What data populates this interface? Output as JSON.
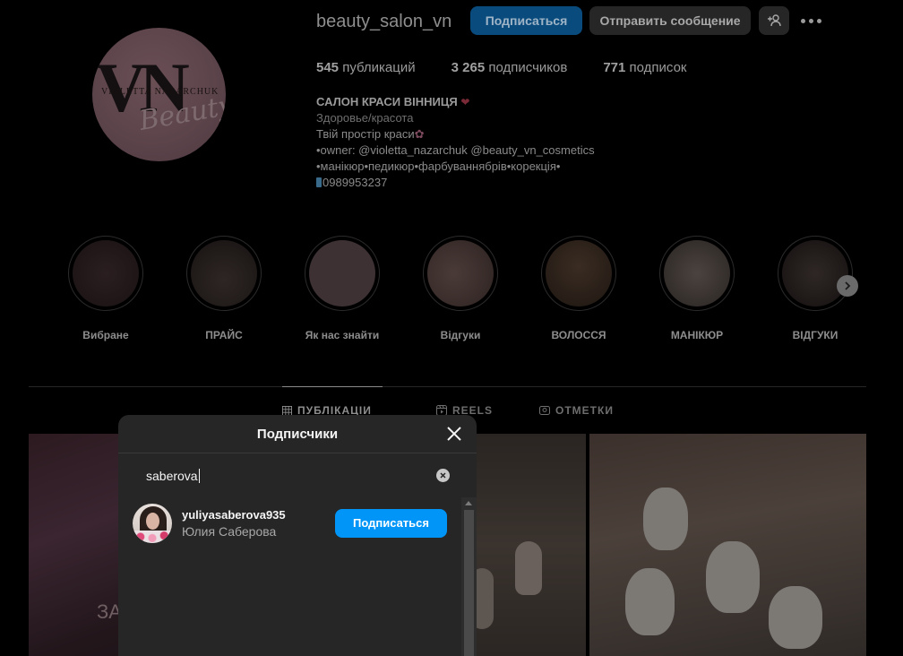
{
  "profile": {
    "username": "beauty_salon_vn",
    "follow_label": "Подписаться",
    "message_label": "Отправить сообщение",
    "avatar": {
      "logo_vn": "VN",
      "logo_name": "VIOLETTA NAZARCHUK",
      "logo_beauty": "Beauty"
    },
    "stats": {
      "posts_count": "545",
      "posts_label": "публикаций",
      "followers_count": "3 265",
      "followers_label": "подписчиков",
      "following_count": "771",
      "following_label": "подписок"
    },
    "bio": {
      "name": "САЛОН КРАСИ ВІННИЦЯ",
      "name_emoji": "❤",
      "category": "Здоровье/красота",
      "line1": "Твій простір краси",
      "line1_emoji": "✿",
      "line2": "•owner: @violetta_nazarchuk @beauty_vn_cosmetics",
      "line3": "•манікюр•педикюр•фарбуваннябрів•корекція•",
      "phone": "0989953237"
    }
  },
  "highlights": [
    {
      "label": "Вибране"
    },
    {
      "label": "ПРАЙС"
    },
    {
      "label": "Як нас знайти"
    },
    {
      "label": "Відгуки"
    },
    {
      "label": "ВОЛОССЯ"
    },
    {
      "label": "МАНІКЮР"
    },
    {
      "label": "ВІДГУКИ"
    }
  ],
  "tabs": [
    {
      "label": "ПУБЛІКАЦІИ",
      "icon": "grid-icon",
      "active": true
    },
    {
      "label": "REELS",
      "icon": "reels-icon",
      "active": false
    },
    {
      "label": "ОТМЕТКИ",
      "icon": "tagged-icon",
      "active": false
    }
  ],
  "posts": {
    "tile1_caption": "ЗА"
  },
  "modal": {
    "title": "Подписчики",
    "search_value": "saberova",
    "results": [
      {
        "username": "yuliyasaberova935",
        "full_name": "Юлия Саберова",
        "follow_label": "Подписаться"
      }
    ]
  },
  "colors": {
    "accent": "#0095f6",
    "modal_bg": "#262626",
    "page_bg": "#000000"
  }
}
